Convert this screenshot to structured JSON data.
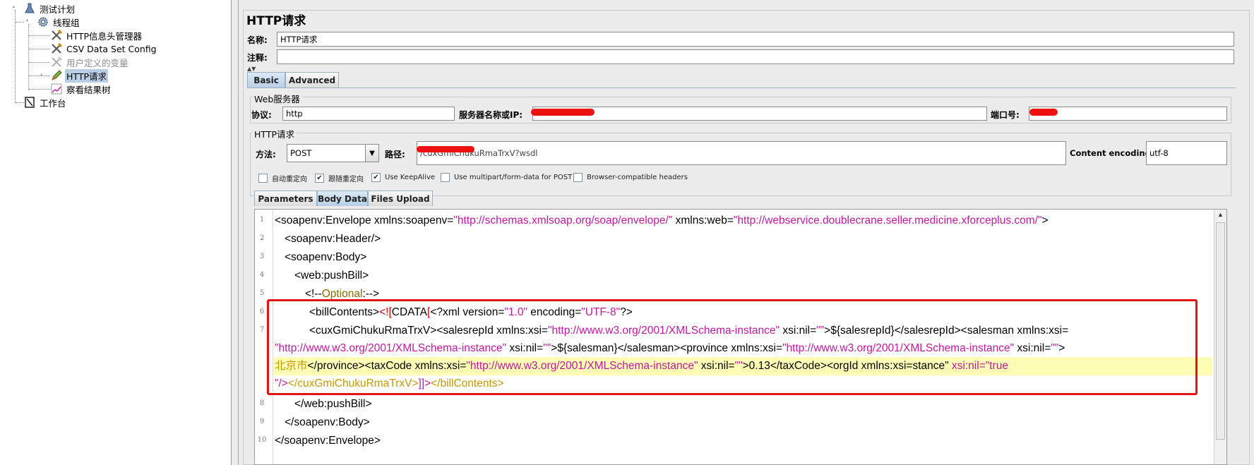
{
  "tree": {
    "items": [
      {
        "label": "测试计划",
        "icon": "flask-icon"
      },
      {
        "label": "线程组",
        "icon": "gear-icon"
      },
      {
        "label": "HTTP信息头管理器",
        "icon": "wrench-icon"
      },
      {
        "label": "CSV Data Set Config",
        "icon": "wrench-icon"
      },
      {
        "label": "用户定义的变量",
        "icon": "wrench-icon"
      },
      {
        "label": "HTTP请求",
        "icon": "pen-icon"
      },
      {
        "label": "察看结果树",
        "icon": "chart-icon"
      },
      {
        "label": "工作台",
        "icon": "workbench-icon"
      }
    ]
  },
  "panel": {
    "title": "HTTP请求",
    "name_label": "名称:",
    "name_value": "HTTP请求",
    "comment_label": "注释:",
    "tabs": [
      {
        "label": "Basic"
      },
      {
        "label": "Advanced"
      }
    ],
    "web_server": {
      "title": "Web服务器",
      "protocol_label": "协议:",
      "protocol_value": "http",
      "server_label": "服务器名称或IP:",
      "port_label": "端口号:"
    },
    "http_request": {
      "title": "HTTP请求",
      "method_label": "方法:",
      "method_value": "POST",
      "path_label": "路径:",
      "path_value": "/cuxGmiChukuRmaTrxV?wsdl",
      "encoding_label": "Content encoding:",
      "encoding_value": "utf-8"
    },
    "checkboxes": [
      {
        "label": "自动重定向",
        "checked": false
      },
      {
        "label": "跟随重定向",
        "checked": true
      },
      {
        "label": "Use KeepAlive",
        "checked": true
      },
      {
        "label": "Use multipart/form-data for POST",
        "checked": false
      },
      {
        "label": "Browser-compatible headers",
        "checked": false
      }
    ],
    "sub_tabs": [
      {
        "label": "Parameters"
      },
      {
        "label": "Body Data"
      },
      {
        "label": "Files Upload"
      }
    ]
  },
  "editor": {
    "line_numbers": [
      "1",
      "2",
      "3",
      "4",
      "5",
      "6",
      "7",
      "8",
      "9",
      "10"
    ],
    "l1": {
      "a": "<soapenv:Envelope xmlns:soapenv=",
      "b": "\"http://schemas.xmlsoap.org/soap/envelope/\"",
      "c": " xmlns:web=",
      "d": "\"http://webservice.doublecrane.seller.medicine.xforceplus.com/\"",
      "e": ">"
    },
    "l2": "<soapenv:Header/>",
    "l3": "<soapenv:Body>",
    "l4": "<web:pushBill>",
    "l5": {
      "a": "<!--",
      "b": "Optional",
      "c": ":-->"
    },
    "l6": {
      "a": "<billContents>",
      "b": "<![",
      "c": "CDATA",
      "d": "[",
      "e": "<?xml version=",
      "f": "\"1.0\"",
      "g": " encoding=",
      "h": "\"UTF-8\"",
      "i": "?>"
    },
    "l7": {
      "a": "<cuxGmiChukuRmaTrxV>",
      "b": "<salesrepId xmlns:xsi=",
      "c": "\"http://www.w3.org/2001/XMLSchema-instance\"",
      "d": " xsi:nil=",
      "e": "\"\"",
      "f": ">${salesrepId}",
      "g": "</salesrepId>",
      "h": "<salesman xmlns:xsi="
    },
    "l7b": {
      "a": "\"http://www.w3.org/2001/XMLSchema-instance\"",
      "b": " xsi:nil=",
      "c": "\"\"",
      "d": ">${salesman}",
      "e": "</salesman>",
      "f": "<province xmlns:xsi=",
      "g": "\"http://www.w3.org/2001/XMLSchema-instance\"",
      "h": " xsi:nil=",
      "i": "\"\"",
      "j": ">"
    },
    "l7c": {
      "a": "北京市",
      "b": "</province>",
      "c": "<taxCode xmlns:xsi=",
      "d": "\"http://www.w3.org/2001/XMLSchema-instance\"",
      "e": " xsi:nil=",
      "f": "\"\"",
      "g": ">0.13",
      "h": "</taxCode>",
      "i": "<orgId xmlns:xsi=stance\"",
      "j": " xsi:nil=",
      "k": "\"true"
    },
    "l7d": {
      "a": "\"/>",
      "b": "</cuxGmiChukuRmaTrxV>",
      "c": "]]>",
      "d": "</billContents>"
    },
    "l8": "</web:pushBill>",
    "l9": "</soapenv:Body>",
    "l10": "</soapenv:Envelope>"
  },
  "colors": {
    "annotation_box": "#e01414",
    "string": "#c2189e",
    "highlight_line": "#fdfdb6",
    "selected_node": "#b9cde5"
  }
}
